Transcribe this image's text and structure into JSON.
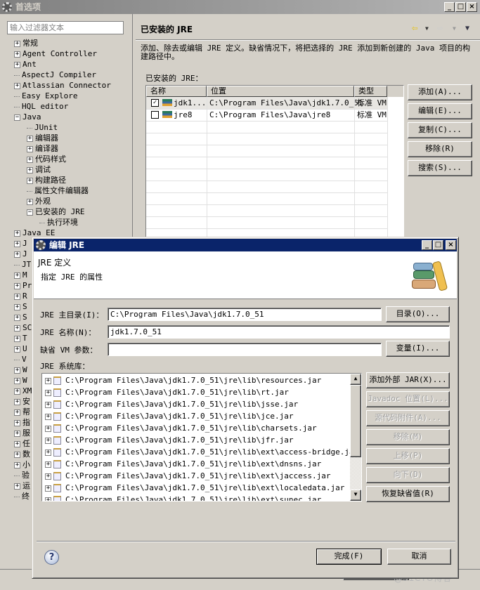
{
  "main_window": {
    "title": "首选项",
    "filter_placeholder": "输入过滤器文本",
    "tree": [
      {
        "label": "常规",
        "level": 0,
        "exp": "+"
      },
      {
        "label": "Agent Controller",
        "level": 0,
        "exp": "+"
      },
      {
        "label": "Ant",
        "level": 0,
        "exp": "+"
      },
      {
        "label": "AspectJ Compiler",
        "level": 0,
        "exp": ""
      },
      {
        "label": "Atlassian Connector",
        "level": 0,
        "exp": "+"
      },
      {
        "label": "Easy Explore",
        "level": 0,
        "exp": ""
      },
      {
        "label": "HQL editor",
        "level": 0,
        "exp": ""
      },
      {
        "label": "Java",
        "level": 0,
        "exp": "-"
      },
      {
        "label": "JUnit",
        "level": 1,
        "exp": ""
      },
      {
        "label": "编辑器",
        "level": 1,
        "exp": "+"
      },
      {
        "label": "编译器",
        "level": 1,
        "exp": "+"
      },
      {
        "label": "代码样式",
        "level": 1,
        "exp": "+"
      },
      {
        "label": "调试",
        "level": 1,
        "exp": "+"
      },
      {
        "label": "构建路径",
        "level": 1,
        "exp": "+"
      },
      {
        "label": "属性文件编辑器",
        "level": 1,
        "exp": ""
      },
      {
        "label": "外观",
        "level": 1,
        "exp": "+"
      },
      {
        "label": "已安装的 JRE",
        "level": 1,
        "exp": "-",
        "selected": true
      },
      {
        "label": "执行环境",
        "level": 2,
        "exp": ""
      },
      {
        "label": "Java EE",
        "level": 0,
        "exp": "+"
      },
      {
        "label": "J",
        "level": 0,
        "exp": "+"
      },
      {
        "label": "J",
        "level": 0,
        "exp": "+"
      },
      {
        "label": "JT",
        "level": 0,
        "exp": ""
      },
      {
        "label": "M",
        "level": 0,
        "exp": "+"
      },
      {
        "label": "Pr",
        "level": 0,
        "exp": "+"
      },
      {
        "label": "R",
        "level": 0,
        "exp": "+"
      },
      {
        "label": "S",
        "level": 0,
        "exp": "+"
      },
      {
        "label": "S",
        "level": 0,
        "exp": "+"
      },
      {
        "label": "SC",
        "level": 0,
        "exp": "+"
      },
      {
        "label": "T",
        "level": 0,
        "exp": "+"
      },
      {
        "label": "U",
        "level": 0,
        "exp": "+"
      },
      {
        "label": "V",
        "level": 0,
        "exp": ""
      },
      {
        "label": "W",
        "level": 0,
        "exp": "+"
      },
      {
        "label": "W",
        "level": 0,
        "exp": "+"
      },
      {
        "label": "XM",
        "level": 0,
        "exp": "+"
      },
      {
        "label": "安",
        "level": 0,
        "exp": "+"
      },
      {
        "label": "帮",
        "level": 0,
        "exp": "+"
      },
      {
        "label": "指",
        "level": 0,
        "exp": "+"
      },
      {
        "label": "服",
        "level": 0,
        "exp": "+"
      },
      {
        "label": "任",
        "level": 0,
        "exp": "+"
      },
      {
        "label": "数",
        "level": 0,
        "exp": "+"
      },
      {
        "label": "小",
        "level": 0,
        "exp": "+"
      },
      {
        "label": "验",
        "level": 0,
        "exp": ""
      },
      {
        "label": "运",
        "level": 0,
        "exp": "+"
      },
      {
        "label": "终",
        "level": 0,
        "exp": ""
      }
    ],
    "page_title": "已安装的 JRE",
    "description": "添加、除去或编辑 JRE 定义。缺省情况下，将把选择的 JRE 添加到新创建的 Java 项目的构建路径中。",
    "table_label": "已安装的 JRE：",
    "columns": [
      "名称",
      "位置",
      "类型"
    ],
    "rows": [
      {
        "checked": true,
        "name": "jdk1...",
        "location": "C:\\Program Files\\Java\\jdk1.7.0_51",
        "type": "标准 VM"
      },
      {
        "checked": false,
        "name": "jre8",
        "location": "C:\\Program Files\\Java\\jre8",
        "type": "标准 VM"
      }
    ],
    "buttons": [
      "添加(A)...",
      "编辑(E)...",
      "复制(C)...",
      "移除(R)",
      "搜索(S)..."
    ]
  },
  "dialog": {
    "title": "编辑 JRE",
    "header_title": "JRE 定义",
    "header_subtitle": "指定 JRE 的属性",
    "home_label": "JRE 主目录(I)：",
    "home_value": "C:\\Program Files\\Java\\jdk1.7.0_51",
    "home_button": "目录(O)...",
    "name_label": "JRE 名称(N)：",
    "name_value": "jdk1.7.0_51",
    "vm_args_label": "缺省 VM 参数：",
    "vm_args_value": "",
    "vm_args_button": "变量(I)...",
    "libs_label": "JRE 系统库：",
    "libs": [
      "C:\\Program Files\\Java\\jdk1.7.0_51\\jre\\lib\\resources.jar",
      "C:\\Program Files\\Java\\jdk1.7.0_51\\jre\\lib\\rt.jar",
      "C:\\Program Files\\Java\\jdk1.7.0_51\\jre\\lib\\jsse.jar",
      "C:\\Program Files\\Java\\jdk1.7.0_51\\jre\\lib\\jce.jar",
      "C:\\Program Files\\Java\\jdk1.7.0_51\\jre\\lib\\charsets.jar",
      "C:\\Program Files\\Java\\jdk1.7.0_51\\jre\\lib\\jfr.jar",
      "C:\\Program Files\\Java\\jdk1.7.0_51\\jre\\lib\\ext\\access-bridge.jar",
      "C:\\Program Files\\Java\\jdk1.7.0_51\\jre\\lib\\ext\\dnsns.jar",
      "C:\\Program Files\\Java\\jdk1.7.0_51\\jre\\lib\\ext\\jaccess.jar",
      "C:\\Program Files\\Java\\jdk1.7.0_51\\jre\\lib\\ext\\localedata.jar",
      "C:\\Program Files\\Java\\jdk1.7.0_51\\jre\\lib\\ext\\sunec.jar"
    ],
    "lib_buttons": [
      {
        "label": "添加外部 JAR(X)...",
        "enabled": true
      },
      {
        "label": "Javadoc 位置(L)...",
        "enabled": false
      },
      {
        "label": "源代码附件(A)...",
        "enabled": false
      },
      {
        "label": "移除(M)",
        "enabled": false
      },
      {
        "label": "上移(P)",
        "enabled": false
      },
      {
        "label": "向下(D)",
        "enabled": false
      },
      {
        "label": "恢复缺省值(R)",
        "enabled": true
      }
    ],
    "finish": "完成(F)",
    "cancel": "取消"
  },
  "watermark": "@51CTO博客"
}
